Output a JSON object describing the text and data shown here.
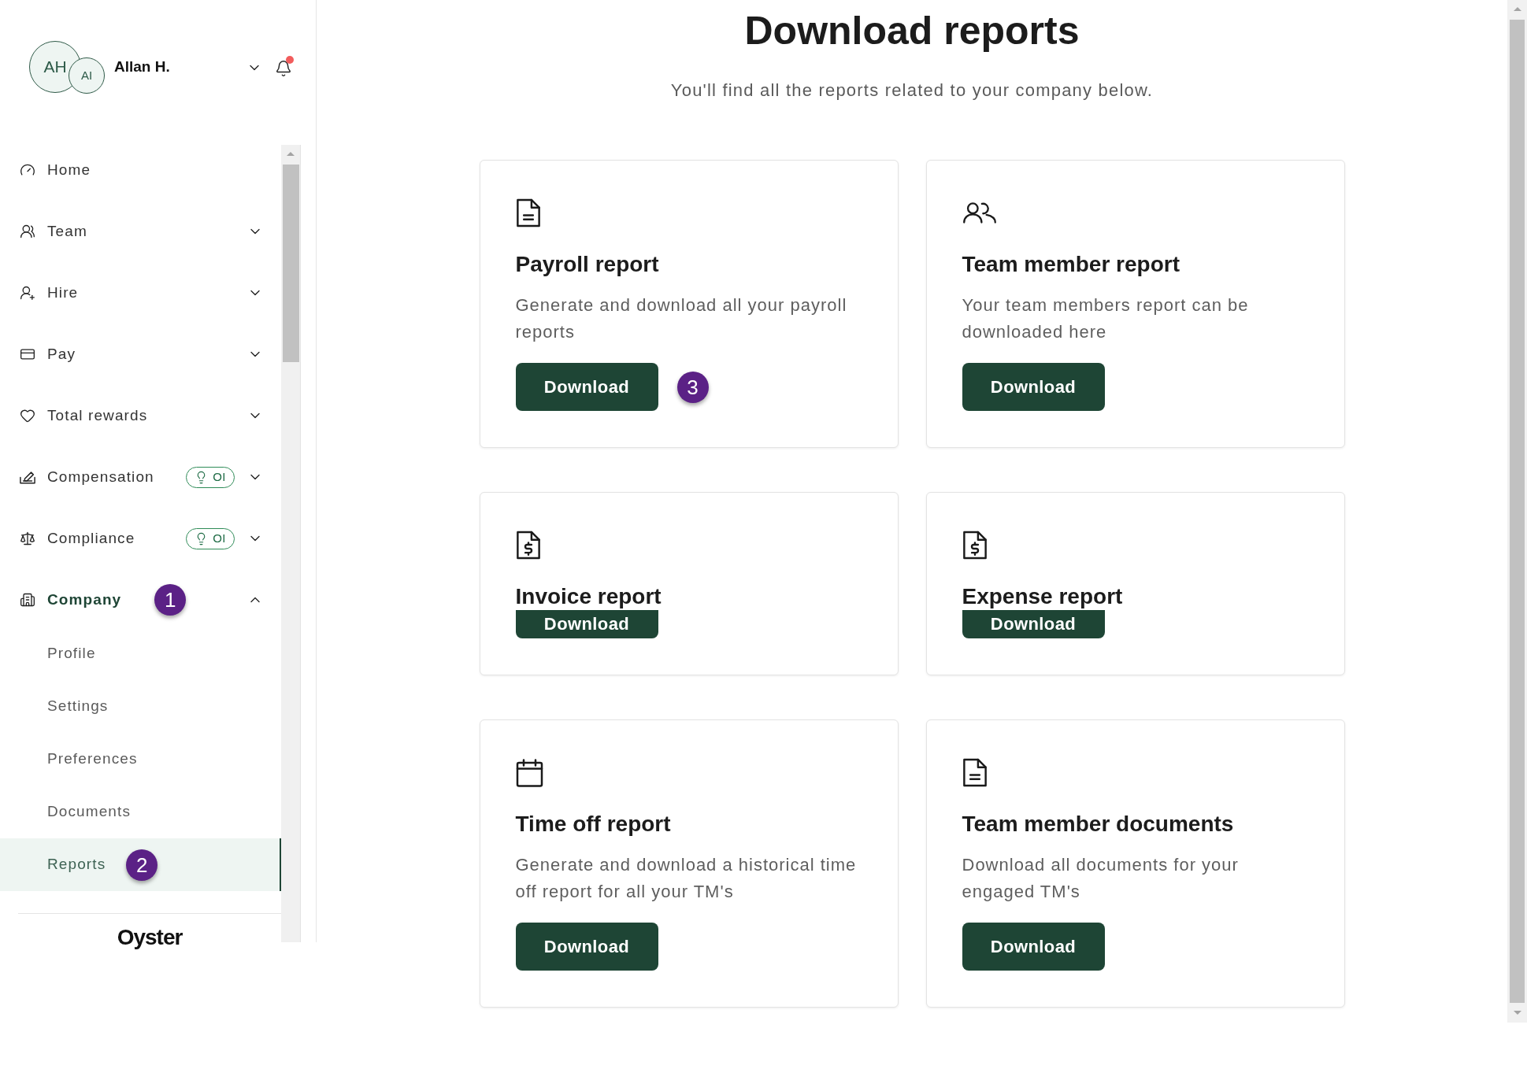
{
  "account": {
    "initials": "AH",
    "secondary_initials": "AI",
    "name": "Allan H.",
    "notifications_unread": true
  },
  "sidebar": {
    "items": [
      {
        "label": "Home",
        "selected": false
      },
      {
        "label": "Team",
        "selected": false,
        "expanded": false
      },
      {
        "label": "Hire",
        "selected": false,
        "expanded": false
      },
      {
        "label": "Pay",
        "selected": false,
        "expanded": false
      },
      {
        "label": "Total rewards",
        "selected": false,
        "expanded": false
      },
      {
        "label": "Compensation",
        "selected": false,
        "expanded": false,
        "badge": "OI"
      },
      {
        "label": "Compliance",
        "selected": false,
        "expanded": false,
        "badge": "OI"
      },
      {
        "label": "Company",
        "selected": true,
        "expanded": true,
        "step_marker": "1",
        "children": [
          {
            "label": "Profile",
            "selected": false
          },
          {
            "label": "Settings",
            "selected": false
          },
          {
            "label": "Preferences",
            "selected": false
          },
          {
            "label": "Documents",
            "selected": false
          },
          {
            "label": "Reports",
            "selected": true,
            "step_marker": "2"
          }
        ]
      }
    ],
    "logo": "Oyster"
  },
  "page": {
    "title": "Download reports",
    "subtitle": "You'll find all the reports related to your company below."
  },
  "reports": [
    {
      "title": "Payroll report",
      "description": "Generate and download all your payroll reports",
      "button": "Download",
      "step_marker": "3"
    },
    {
      "title": "Team member report",
      "description": "Your team members report can be downloaded here",
      "button": "Download"
    },
    {
      "title": "Invoice report",
      "button": "Download"
    },
    {
      "title": "Expense report",
      "button": "Download"
    },
    {
      "title": "Time off report",
      "description": "Generate and download a historical time off report for all your TM's",
      "button": "Download"
    },
    {
      "title": "Team member documents",
      "description": "Download all documents for your engaged TM's",
      "button": "Download"
    }
  ]
}
